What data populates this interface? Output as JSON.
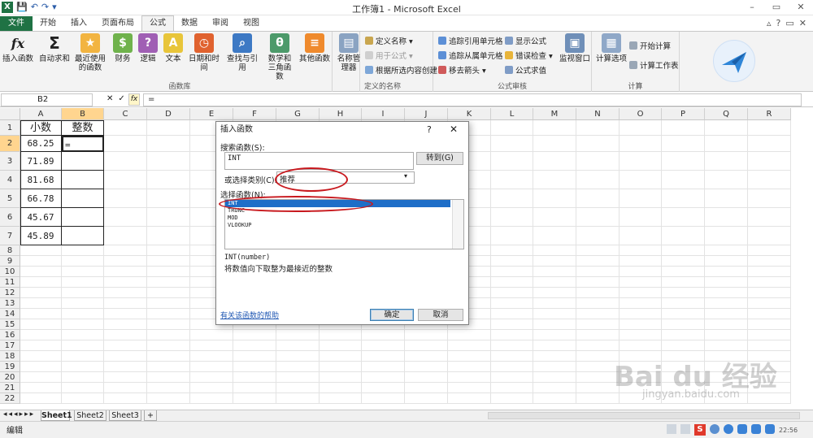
{
  "window": {
    "title": "工作簿1 - Microsoft Excel",
    "min": "–",
    "restore": "▭",
    "close": "✕"
  },
  "qat": {
    "excel_icon": "X",
    "save": "💾",
    "undo": "↶",
    "redo": "↷",
    "more": "▾"
  },
  "tabs": [
    "文件",
    "开始",
    "插入",
    "页面布局",
    "公式",
    "数据",
    "审阅",
    "视图"
  ],
  "tabs_right": {
    "min": "▵",
    "help": "?",
    "restore": "▭",
    "close": "✕"
  },
  "ribbon": {
    "group_functionlib": {
      "label": "函数库",
      "buttons": [
        "插入函数",
        "自动求和",
        "最近使用的函数",
        "财务",
        "逻辑",
        "文本",
        "日期和时间",
        "查找与引用",
        "数学和三角函数",
        "其他函数"
      ]
    },
    "group_names": {
      "label": "定义的名称",
      "name_manager": "名称管理器",
      "define_name": "定义名称 ▾",
      "use_in_formula": "用于公式 ▾",
      "create_from_selection": "根据所选内容创建"
    },
    "group_audit": {
      "label": "公式审核",
      "trace_precedents": "追踪引用单元格",
      "trace_dependents": "追踪从属单元格",
      "remove_arrows": "移去箭头 ▾",
      "show_formulas": "显示公式",
      "error_check": "错误检查 ▾",
      "evaluate": "公式求值",
      "watch": "监视窗口"
    },
    "group_calc": {
      "label": "计算",
      "calc_options": "计算选项",
      "calc_now": "开始计算",
      "calc_sheet": "计算工作表"
    }
  },
  "formula_bar": {
    "name_box": "B2",
    "cancel": "✕",
    "enter": "✓",
    "fx": "fx",
    "formula": "="
  },
  "grid": {
    "columns": [
      "A",
      "B",
      "C",
      "D",
      "E",
      "F",
      "G",
      "H",
      "I",
      "J",
      "K",
      "L",
      "M",
      "N",
      "O",
      "P",
      "Q",
      "R"
    ],
    "rows": [
      "1",
      "2",
      "3",
      "4",
      "5",
      "6",
      "7",
      "8",
      "9",
      "10",
      "11",
      "12",
      "13",
      "14",
      "15",
      "16",
      "17",
      "18",
      "19",
      "20",
      "21",
      "22"
    ],
    "header_a": "小数",
    "header_b": "整数",
    "values_a": [
      "68.25",
      "71.89",
      "81.68",
      "66.78",
      "45.67",
      "45.89"
    ],
    "b2": "="
  },
  "sheets": [
    "Sheet1",
    "Sheet2",
    "Sheet3"
  ],
  "status": {
    "mode": "编辑",
    "zoom": "",
    "clock": "22:56"
  },
  "dialog": {
    "title": "插入函数",
    "help": "?",
    "close": "✕",
    "search_label": "搜索函数(S):",
    "search_value": "INT",
    "go_button": "转到(G)",
    "category_label": "或选择类别(C):",
    "category_value": "推荐",
    "select_label": "选择函数(N):",
    "functions": [
      "INT",
      "TRUNC",
      "MOD",
      "VLOOKUP"
    ],
    "signature": "INT(number)",
    "description": "将数值向下取整为最接近的整数",
    "help_link": "有关该函数的帮助",
    "ok": "确定",
    "cancel": "取消"
  },
  "watermark": {
    "brand": "Bai du 经验",
    "url": "jingyan.baidu.com"
  },
  "colors": {
    "excel_green": "#1f7244",
    "selection": "#1e6ec8",
    "annotation_red": "#c8191e"
  }
}
